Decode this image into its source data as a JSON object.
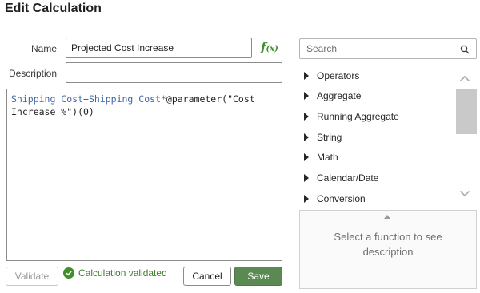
{
  "dialog": {
    "title": "Edit Calculation"
  },
  "form": {
    "name_label": "Name",
    "name_value": "Projected Cost Increase",
    "fx_label": "f",
    "fx_sub": "(x)",
    "description_label": "Description",
    "description_value": ""
  },
  "expression": {
    "part1": "Shipping Cost",
    "part2": "+",
    "part3": "Shipping Cost",
    "part4": "*",
    "part5": "@parameter(\"Cost Increase %\")(0)"
  },
  "footer": {
    "validate_label": "Validate",
    "status_text": "Calculation validated",
    "cancel_label": "Cancel",
    "save_label": "Save"
  },
  "functions": {
    "search_placeholder": "Search",
    "items": [
      {
        "label": "Operators"
      },
      {
        "label": "Aggregate"
      },
      {
        "label": "Running Aggregate"
      },
      {
        "label": "String"
      },
      {
        "label": "Math"
      },
      {
        "label": "Calendar/Date"
      },
      {
        "label": "Conversion"
      }
    ],
    "description_hint": "Select a function to see description"
  },
  "colors": {
    "accent_green": "#3f8f2a",
    "save_button": "#5a8a52",
    "field_token": "#3d66a8"
  },
  "icons": [
    "function-icon",
    "search-icon",
    "chevron-up-icon",
    "chevron-down-icon",
    "checkmark-icon",
    "caret-right-icon"
  ]
}
